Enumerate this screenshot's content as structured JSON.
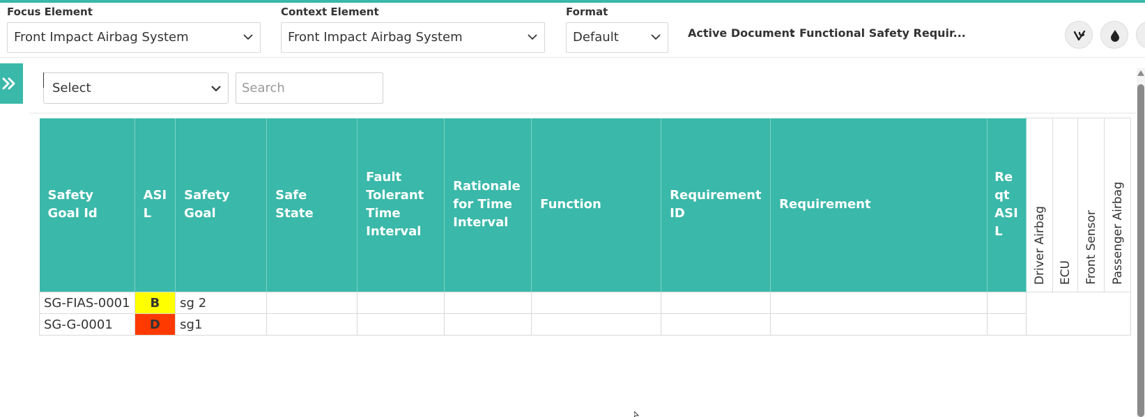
{
  "toolbar": {
    "focus_label": "Focus Element",
    "focus_value": "Front Impact Airbag System",
    "context_label": "Context Element",
    "context_value": "Front Impact Airbag System",
    "format_label": "Format",
    "format_value": "Default",
    "active_doc_label": "Active Document",
    "active_doc_value": ": Functional Safety Requir..."
  },
  "filter": {
    "select_value": "Select",
    "search_placeholder": "Search"
  },
  "table": {
    "headers": {
      "safety_goal_id": "Safety Goal Id",
      "asil": "ASI L",
      "safety_goal": "Safety Goal",
      "safe_state": "Safe State",
      "ftti": "Fault Tolerant Time Interval",
      "rationale": "Rationale for Time Interval",
      "function": "Function",
      "requirement_id": "Requirement ID",
      "requirement": "Requirement",
      "reqt_asil": "Re qt ASI L",
      "elements": [
        "Driver Airbag",
        "ECU",
        "Front Sensor",
        "Passenger Airbag"
      ]
    },
    "rows": [
      {
        "id": "SG-FIAS-0001",
        "asil": "B",
        "asil_color": "#ffff00",
        "goal": "sg 2"
      },
      {
        "id": "SG-G-0001",
        "asil": "D",
        "asil_color": "#ff3a00",
        "goal": "sg1"
      }
    ]
  },
  "colors": {
    "accent": "#3ab8a9",
    "grey_cell": "#e6e6e6"
  }
}
